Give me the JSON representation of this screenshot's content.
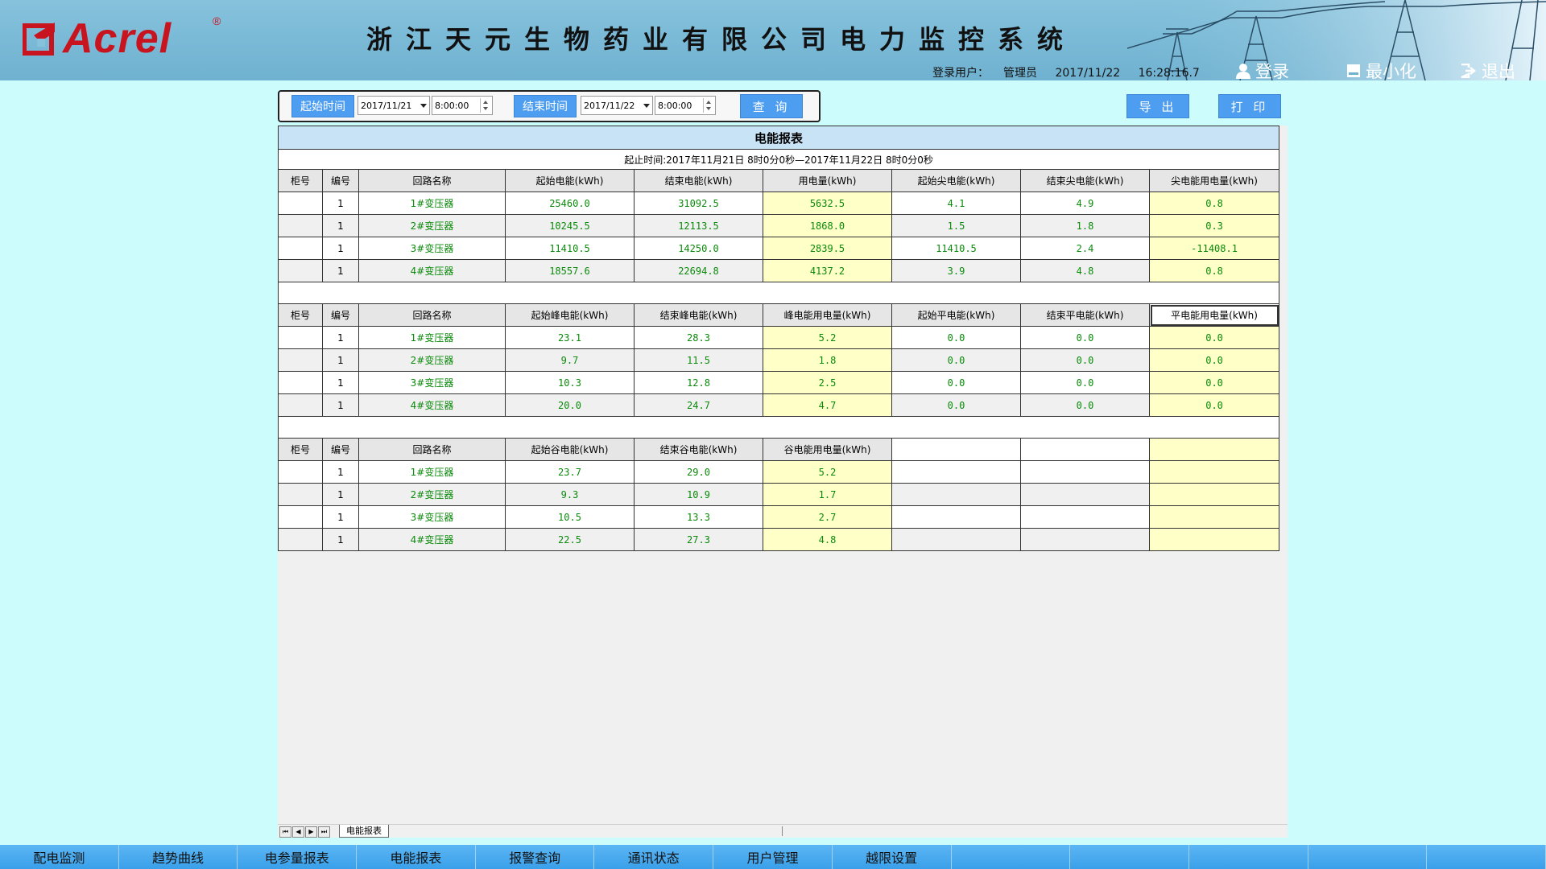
{
  "header": {
    "logo_text": "Acrel",
    "logo_reg": "®",
    "title": "浙江天元生物药业有限公司电力监控系统",
    "user_label": "登录用户：",
    "user_name": "管理员",
    "date": "2017/11/22",
    "time": "16:28:16.7",
    "login_label": "登录",
    "minimize_label": "最小化",
    "exit_label": "退出"
  },
  "query": {
    "start_label": "起始时间",
    "start_date": "2017/11/21",
    "start_time": "8:00:00",
    "end_label": "结束时间",
    "end_date": "2017/11/22",
    "end_time": "8:00:00",
    "query_label": "查 询",
    "export_label": "导 出",
    "print_label": "打 印"
  },
  "report": {
    "title": "电能报表",
    "range": "起止时间:2017年11月21日 8时0分0秒—2017年11月22日 8时0分0秒",
    "sections": [
      {
        "headers": [
          "柜号",
          "编号",
          "回路名称",
          "起始电能(kWh)",
          "结束电能(kWh)",
          "用电量(kWh)",
          "起始尖电能(kWh)",
          "结束尖电能(kWh)",
          "尖电能用电量(kWh)"
        ],
        "rows": [
          [
            "",
            "1",
            "1#变压器",
            "25460.0",
            "31092.5",
            "5632.5",
            "4.1",
            "4.9",
            "0.8"
          ],
          [
            "",
            "1",
            "2#变压器",
            "10245.5",
            "12113.5",
            "1868.0",
            "1.5",
            "1.8",
            "0.3"
          ],
          [
            "",
            "1",
            "3#变压器",
            "11410.5",
            "14250.0",
            "2839.5",
            "11410.5",
            "2.4",
            "-11408.1"
          ],
          [
            "",
            "1",
            "4#变压器",
            "18557.6",
            "22694.8",
            "4137.2",
            "3.9",
            "4.8",
            "0.8"
          ]
        ]
      },
      {
        "headers": [
          "柜号",
          "编号",
          "回路名称",
          "起始峰电能(kWh)",
          "结束峰电能(kWh)",
          "峰电能用电量(kWh)",
          "起始平电能(kWh)",
          "结束平电能(kWh)",
          "平电能用电量(kWh)"
        ],
        "rows": [
          [
            "",
            "1",
            "1#变压器",
            "23.1",
            "28.3",
            "5.2",
            "0.0",
            "0.0",
            "0.0"
          ],
          [
            "",
            "1",
            "2#变压器",
            "9.7",
            "11.5",
            "1.8",
            "0.0",
            "0.0",
            "0.0"
          ],
          [
            "",
            "1",
            "3#变压器",
            "10.3",
            "12.8",
            "2.5",
            "0.0",
            "0.0",
            "0.0"
          ],
          [
            "",
            "1",
            "4#变压器",
            "20.0",
            "24.7",
            "4.7",
            "0.0",
            "0.0",
            "0.0"
          ]
        ]
      },
      {
        "headers": [
          "柜号",
          "编号",
          "回路名称",
          "起始谷电能(kWh)",
          "结束谷电能(kWh)",
          "谷电能用电量(kWh)",
          "",
          "",
          ""
        ],
        "rows": [
          [
            "",
            "1",
            "1#变压器",
            "23.7",
            "29.0",
            "5.2",
            "",
            "",
            ""
          ],
          [
            "",
            "1",
            "2#变压器",
            "9.3",
            "10.9",
            "1.7",
            "",
            "",
            ""
          ],
          [
            "",
            "1",
            "3#变压器",
            "10.5",
            "13.3",
            "2.7",
            "",
            "",
            ""
          ],
          [
            "",
            "1",
            "4#变压器",
            "22.5",
            "27.3",
            "4.8",
            "",
            "",
            ""
          ]
        ]
      }
    ]
  },
  "sheet_tab": "电能报表",
  "nav": [
    "配电监测",
    "趋势曲线",
    "电参量报表",
    "电能报表",
    "报警查询",
    "通讯状态",
    "用户管理",
    "越限设置",
    "",
    "",
    "",
    "",
    ""
  ]
}
